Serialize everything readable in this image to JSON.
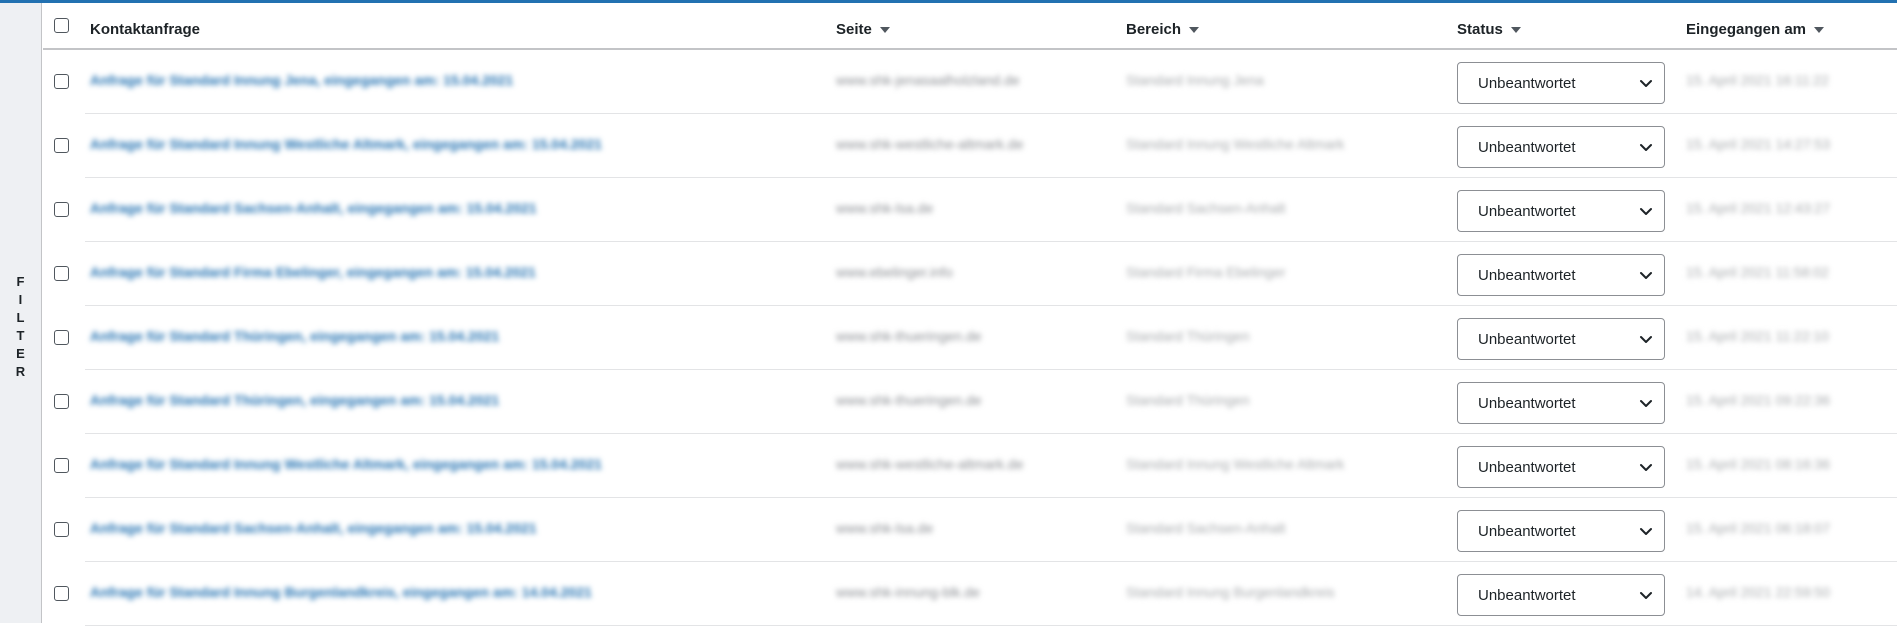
{
  "filter_rail": {
    "letters": [
      "F",
      "I",
      "L",
      "T",
      "E",
      "R"
    ]
  },
  "table": {
    "columns": {
      "title": "Kontaktanfrage",
      "page": "Seite",
      "area": "Bereich",
      "status": "Status",
      "date": "Eingegangen am"
    },
    "rows": [
      {
        "title": "Anfrage für Standard Innung Jena, eingegangen am: 15.04.2021",
        "page": "www.shk-jenasaalholzland.de",
        "area": "Standard Innung Jena",
        "status": "Unbeantwortet",
        "date": "15. April 2021 16:11:22"
      },
      {
        "title": "Anfrage für Standard Innung Westliche Altmark, eingegangen am: 15.04.2021",
        "page": "www.shk-westliche-altmark.de",
        "area": "Standard Innung Westliche Altmark",
        "status": "Unbeantwortet",
        "date": "15. April 2021 14:27:53"
      },
      {
        "title": "Anfrage für Standard Sachsen-Anhalt, eingegangen am: 15.04.2021",
        "page": "www.shk-lsa.de",
        "area": "Standard Sachsen-Anhalt",
        "status": "Unbeantwortet",
        "date": "15. April 2021 12:43:27"
      },
      {
        "title": "Anfrage für Standard Firma Ebelinger, eingegangen am: 15.04.2021",
        "page": "www.ebelinger.info",
        "area": "Standard Firma Ebelinger",
        "status": "Unbeantwortet",
        "date": "15. April 2021 11:58:02"
      },
      {
        "title": "Anfrage für Standard Thüringen, eingegangen am: 15.04.2021",
        "page": "www.shk-thueringen.de",
        "area": "Standard Thüringen",
        "status": "Unbeantwortet",
        "date": "15. April 2021 11:22:10"
      },
      {
        "title": "Anfrage für Standard Thüringen, eingegangen am: 15.04.2021",
        "page": "www.shk-thueringen.de",
        "area": "Standard Thüringen",
        "status": "Unbeantwortet",
        "date": "15. April 2021 09:22:36"
      },
      {
        "title": "Anfrage für Standard Innung Westliche Altmark, eingegangen am: 15.04.2021",
        "page": "www.shk-westliche-altmark.de",
        "area": "Standard Innung Westliche Altmark",
        "status": "Unbeantwortet",
        "date": "15. April 2021 08:16:36"
      },
      {
        "title": "Anfrage für Standard Sachsen-Anhalt, eingegangen am: 15.04.2021",
        "page": "www.shk-lsa.de",
        "area": "Standard Sachsen-Anhalt",
        "status": "Unbeantwortet",
        "date": "15. April 2021 06:18:07"
      },
      {
        "title": "Anfrage für Standard Innung Burgenlandkreis, eingegangen am: 14.04.2021",
        "page": "www.shk-innung-blk.de",
        "area": "Standard Innung Burgenlandkreis",
        "status": "Unbeantwortet",
        "date": "14. April 2021 22:59:50"
      }
    ]
  },
  "colors": {
    "accent": "#2271b1",
    "border": "#c3c4c7",
    "rail_bg": "#eef0f3"
  }
}
